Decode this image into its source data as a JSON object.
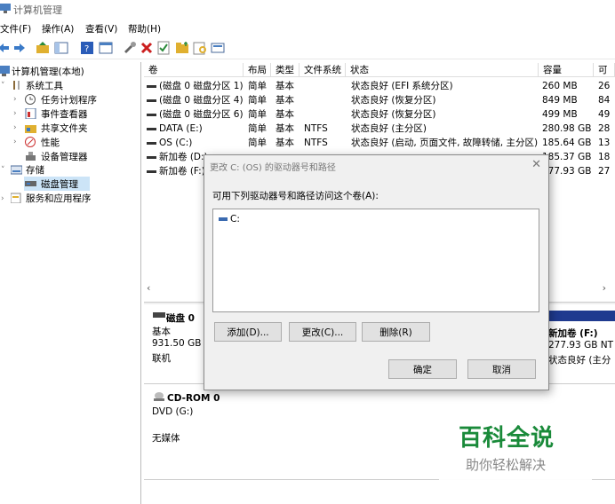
{
  "window": {
    "title": "计算机管理"
  },
  "menu": [
    "文件(F)",
    "操作(A)",
    "查看(V)",
    "帮助(H)"
  ],
  "toolbar": {
    "icons": [
      "back-arrow-icon",
      "forward-arrow-icon",
      "up-folder-icon",
      "show-tree-icon",
      "help-icon",
      "properties-icon",
      "connect-icon",
      "delete-icon",
      "check-icon",
      "folder-icon",
      "search-folder-icon",
      "view-icon"
    ],
    "colors": {
      "delete": "#cc1f1f",
      "check": "#2a8a3a",
      "folder": "#e0b030"
    }
  },
  "tree": {
    "root": "计算机管理(本地)",
    "system_tools": "系统工具",
    "task_scheduler": "任务计划程序",
    "event_viewer": "事件查看器",
    "shared_folders": "共享文件夹",
    "performance": "性能",
    "device_manager": "设备管理器",
    "storage": "存储",
    "disk_management": "磁盘管理",
    "services": "服务和应用程序"
  },
  "table": {
    "headers": [
      "卷",
      "布局",
      "类型",
      "文件系统",
      "状态",
      "容量",
      "可"
    ],
    "rows": [
      {
        "vol": "(磁盘 0 磁盘分区 1)",
        "layout": "简单",
        "type": "基本",
        "fs": "",
        "status": "状态良好 (EFI 系统分区)",
        "cap": "260 MB",
        "free": "26"
      },
      {
        "vol": "(磁盘 0 磁盘分区 4)",
        "layout": "简单",
        "type": "基本",
        "fs": "",
        "status": "状态良好 (恢复分区)",
        "cap": "849 MB",
        "free": "84"
      },
      {
        "vol": "(磁盘 0 磁盘分区 6)",
        "layout": "简单",
        "type": "基本",
        "fs": "",
        "status": "状态良好 (恢复分区)",
        "cap": "499 MB",
        "free": "49"
      },
      {
        "vol": "DATA (E:)",
        "layout": "简单",
        "type": "基本",
        "fs": "NTFS",
        "status": "状态良好 (主分区)",
        "cap": "280.98 GB",
        "free": "28"
      },
      {
        "vol": "OS (C:)",
        "layout": "简单",
        "type": "基本",
        "fs": "NTFS",
        "status": "状态良好 (启动, 页面文件, 故障转储, 主分区)",
        "cap": "185.64 GB",
        "free": "13"
      },
      {
        "vol": "新加卷 (D:)",
        "layout": "",
        "type": "",
        "fs": "",
        "status": "",
        "cap": "185.37 GB",
        "free": "18"
      },
      {
        "vol": "新加卷 (F:)",
        "layout": "",
        "type": "",
        "fs": "",
        "status": "",
        "cap": "277.93 GB",
        "free": "27"
      }
    ]
  },
  "disks": {
    "disk0": {
      "name": "磁盘 0",
      "type": "基本",
      "size": "931.50 GB",
      "state": "联机"
    },
    "partition_f": {
      "name": "新加卷 (F:)",
      "size": "277.93 GB NT",
      "status": "状态良好 (主分"
    },
    "cdrom": {
      "name": "CD-ROM 0",
      "drive": "DVD (G:)",
      "media": "无媒体"
    }
  },
  "dialog": {
    "title": "更改 C: (OS) 的驱动器号和路径",
    "instruction": "可用下列驱动器号和路径访问这个卷(A):",
    "list_items": [
      "C:"
    ],
    "add": "添加(D)...",
    "change": "更改(C)...",
    "remove": "删除(R)",
    "ok": "确定",
    "cancel": "取消"
  },
  "watermark": {
    "title": "百科全说",
    "subtitle": "助你轻松解决",
    "color": "#1a8a3a"
  }
}
